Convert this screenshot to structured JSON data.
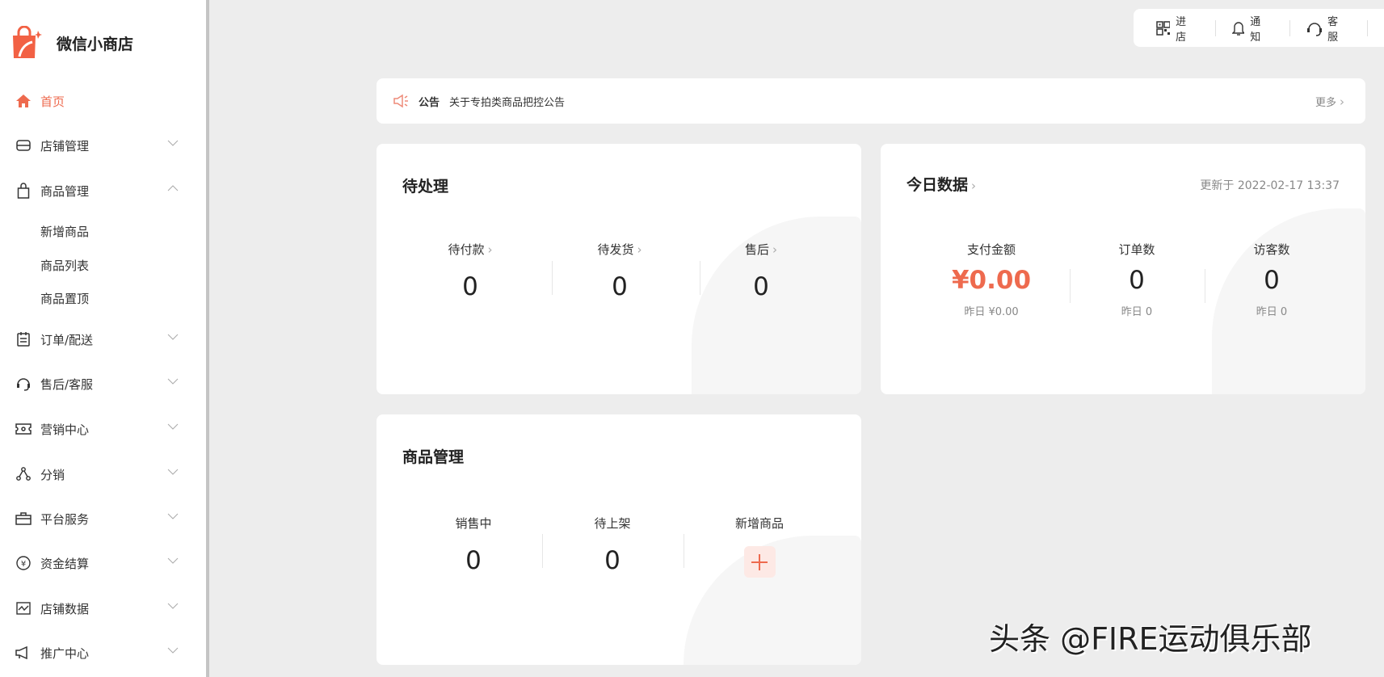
{
  "app": {
    "name": "微信小商店",
    "brand_color": "#ee6a4e"
  },
  "sidebar": {
    "items": [
      {
        "label": "首页",
        "icon": "home-icon",
        "active": true
      },
      {
        "label": "店铺管理",
        "icon": "store-icon",
        "expanded": false
      },
      {
        "label": "商品管理",
        "icon": "bag-icon",
        "expanded": true,
        "children": [
          "新增商品",
          "商品列表",
          "商品置顶"
        ]
      },
      {
        "label": "订单/配送",
        "icon": "clipboard-icon",
        "expanded": false
      },
      {
        "label": "售后/客服",
        "icon": "headset-icon",
        "expanded": false
      },
      {
        "label": "营销中心",
        "icon": "ticket-icon",
        "expanded": false
      },
      {
        "label": "分销",
        "icon": "share-icon",
        "expanded": false
      },
      {
        "label": "平台服务",
        "icon": "briefcase-icon",
        "expanded": false
      },
      {
        "label": "资金结算",
        "icon": "yuan-icon",
        "expanded": false
      },
      {
        "label": "店铺数据",
        "icon": "chart-icon",
        "expanded": false
      },
      {
        "label": "推广中心",
        "icon": "megaphone-icon",
        "expanded": false
      }
    ]
  },
  "topbar": {
    "items": [
      {
        "label": "进店",
        "icon": "qrcode-icon"
      },
      {
        "label": "通知",
        "icon": "bell-icon"
      },
      {
        "label": "客服",
        "icon": "headset-icon"
      }
    ]
  },
  "notice": {
    "tag": "公告",
    "text": "关于专拍类商品把控公告",
    "more": "更多"
  },
  "pending": {
    "title": "待处理",
    "items": [
      {
        "label": "待付款",
        "value": "0"
      },
      {
        "label": "待发货",
        "value": "0"
      },
      {
        "label": "售后",
        "value": "0"
      }
    ]
  },
  "today": {
    "title": "今日数据",
    "updated": "更新于 2022-02-17 13:37",
    "items": [
      {
        "label": "支付金额",
        "value": "¥0.00",
        "yesterday": "昨日 ¥0.00"
      },
      {
        "label": "订单数",
        "value": "0",
        "yesterday": "昨日 0"
      },
      {
        "label": "访客数",
        "value": "0",
        "yesterday": "昨日 0"
      }
    ]
  },
  "products": {
    "title": "商品管理",
    "items": [
      {
        "label": "销售中",
        "value": "0"
      },
      {
        "label": "待上架",
        "value": "0"
      }
    ],
    "add_label": "新增商品"
  },
  "watermark": "头条 @FIRE运动俱乐部"
}
